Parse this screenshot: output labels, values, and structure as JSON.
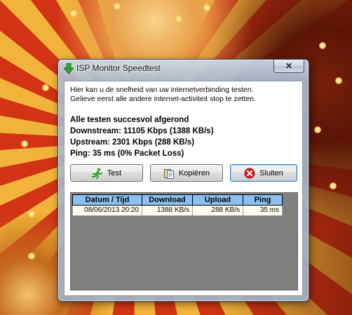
{
  "window": {
    "title": "ISP Monitor Speedtest",
    "close_symbol": "✕",
    "icon": "green-down-arrow-icon"
  },
  "intro": {
    "line1": "Hier kan u de snelheid van uw internetverbinding testen.",
    "line2": "Gelieve eerst alle andere internet-activiteit stop te zetten."
  },
  "status": {
    "headline": "Alle testen succesvol afgerond",
    "downstream": "Downstream: 11105 Kbps (1388 KB/s)",
    "upstream": "Upstream: 2301 Kbps (288 KB/s)",
    "ping": "Ping: 35 ms (0% Packet Loss)"
  },
  "buttons": {
    "test": "Test",
    "copy": "Kopiëren",
    "close": "Sluiten"
  },
  "results": {
    "columns": [
      "Datum / Tijd",
      "Download",
      "Upload",
      "Ping"
    ],
    "rows": [
      [
        "08/06/2013 20:20",
        "1388 KB/s",
        "288 KB/s",
        "35 ms"
      ]
    ]
  },
  "colors": {
    "header_bg": "#8cc0f0",
    "grid_bg": "#808080",
    "close_icon": "#d4202a",
    "run_icon": "#1fa31f"
  }
}
